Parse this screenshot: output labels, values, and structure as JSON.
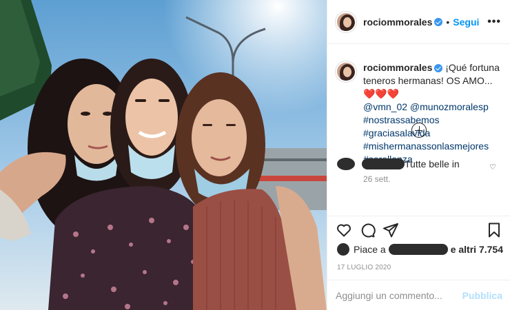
{
  "post": {
    "author": "rociommorales",
    "follow_label": "Segui",
    "separator": "•",
    "more_icon": "more-options-icon"
  },
  "caption": {
    "author": "rociommorales",
    "text": "¡Qué fortuna teneros hermanas! OS AMO...",
    "hearts": "❤️❤️❤️",
    "mentions": [
      "@vmn_02",
      "@munozmoralesp"
    ],
    "hashtags": [
      "#nostrassabemos",
      "#graciasalavida",
      "#mishermanassonlasmejores",
      "#sorellanza"
    ],
    "time_ago": "26 sett."
  },
  "second_comment": {
    "text": "Tutte belle in"
  },
  "actions": {
    "like_icon": "heart-icon",
    "comment_icon": "comment-icon",
    "share_icon": "share-icon",
    "save_icon": "bookmark-icon"
  },
  "likes": {
    "prefix": "Piace a",
    "suffix": "e altri 7.754"
  },
  "date": "17 LUGLIO 2020",
  "comment_box": {
    "placeholder": "Aggiungi un commento...",
    "publish_label": "Pubblica"
  },
  "colors": {
    "accent": "#0095f6",
    "verified": "#3897f0",
    "heart": "#ed4956",
    "hashtag": "#00376b"
  }
}
